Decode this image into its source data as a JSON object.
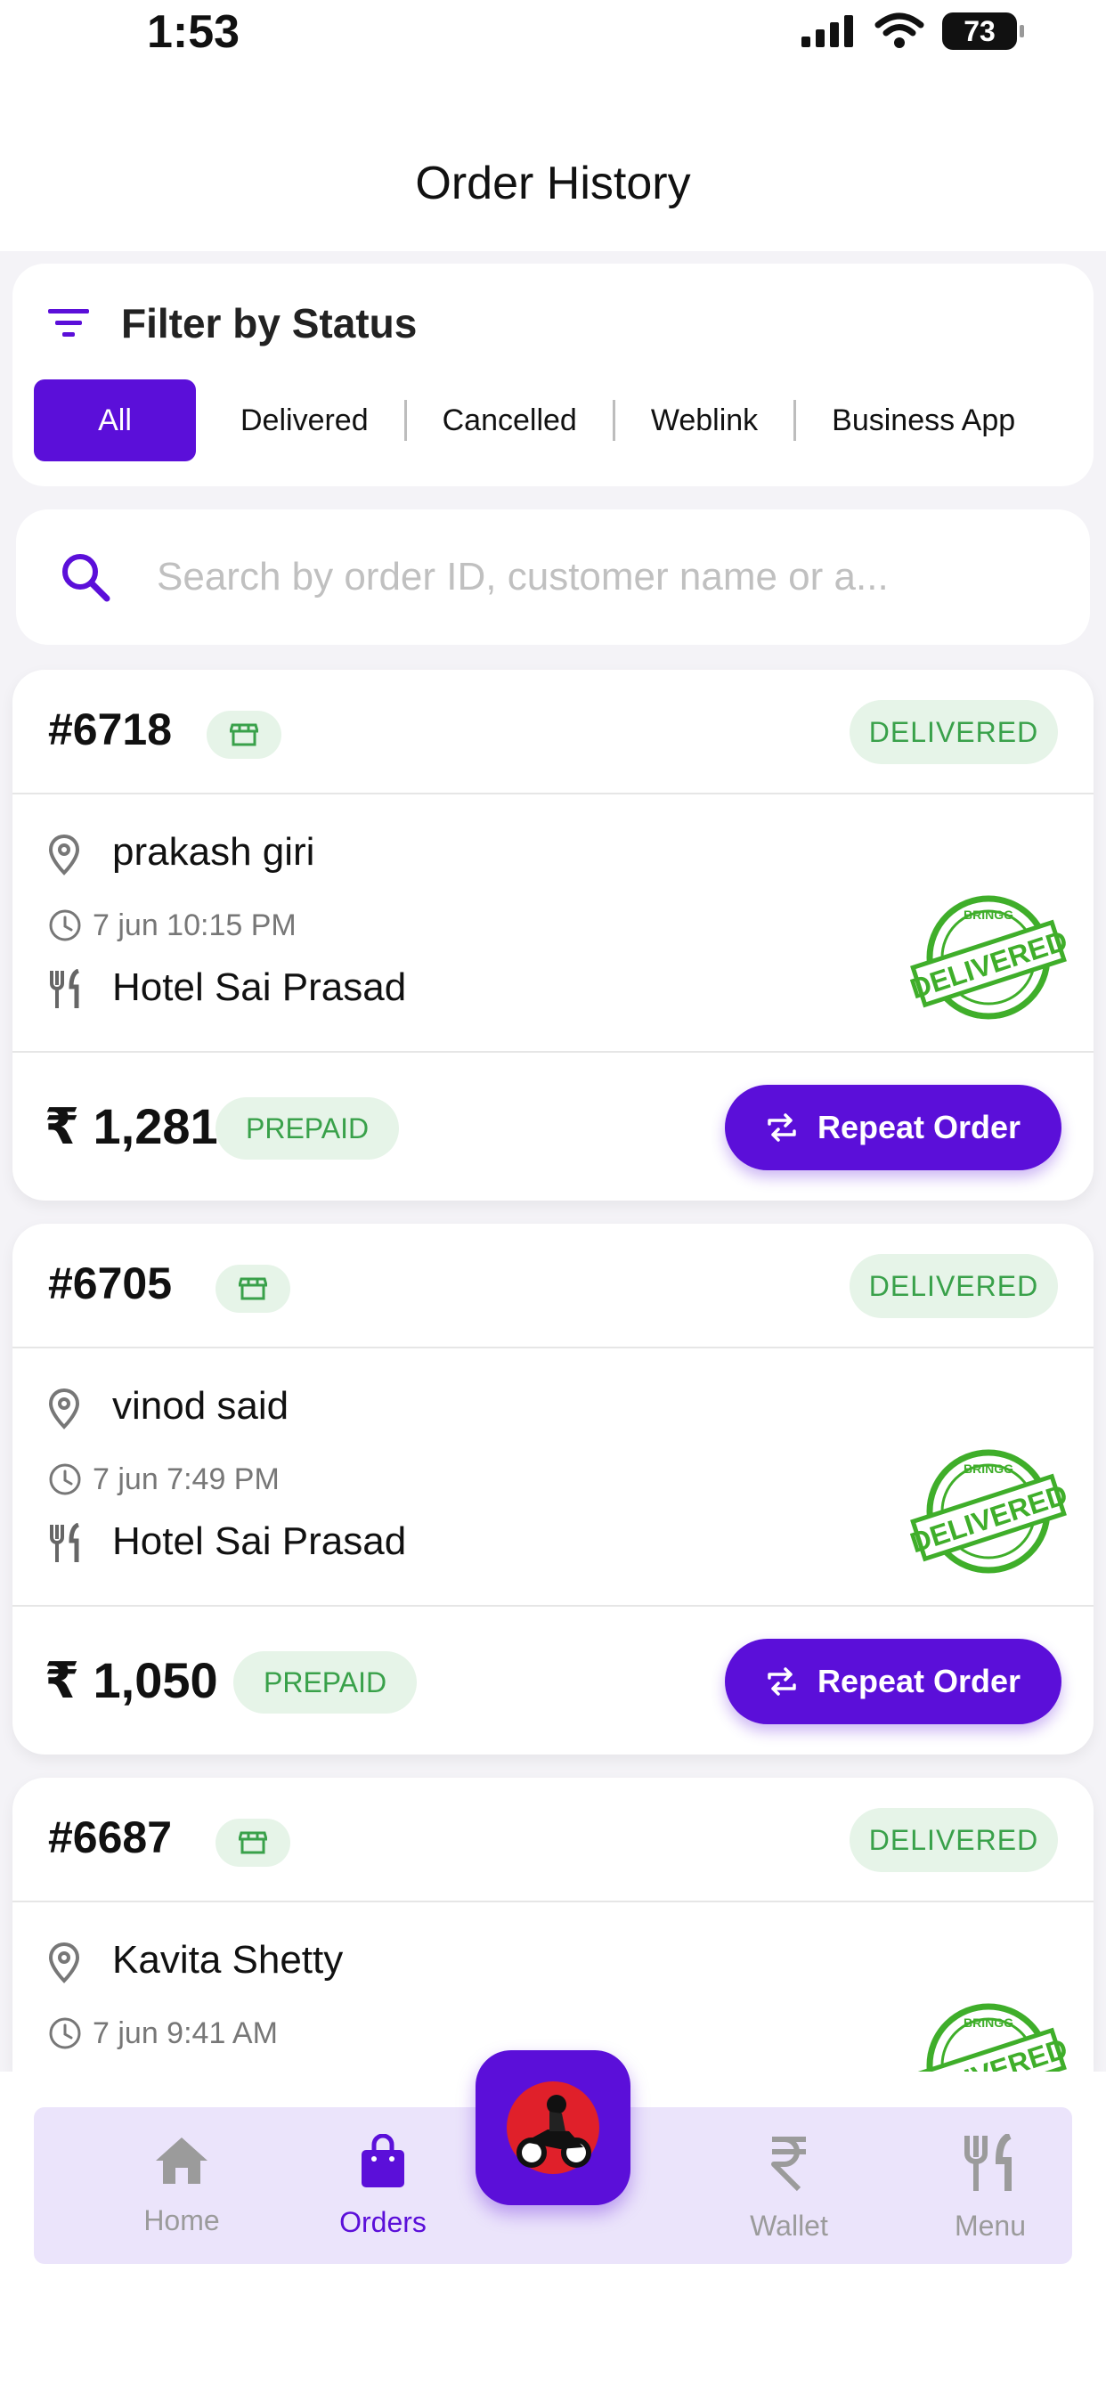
{
  "status_bar": {
    "time": "1:53",
    "battery": "73"
  },
  "header": {
    "title": "Order History"
  },
  "filter": {
    "title": "Filter by Status",
    "chips": [
      "All",
      "Delivered",
      "Cancelled",
      "Weblink",
      "Business App"
    ],
    "active": "All"
  },
  "search": {
    "placeholder": "Search by order ID, customer name or a..."
  },
  "orders": [
    {
      "id": "#6718",
      "status": "DELIVERED",
      "customer": "prakash giri",
      "time": "7 jun 10:15 PM",
      "restaurant": "Hotel Sai Prasad",
      "price": "₹ 1,281",
      "payment": "PREPAID",
      "action": "Repeat Order"
    },
    {
      "id": "#6705",
      "status": "DELIVERED",
      "customer": "vinod said",
      "time": "7 jun 7:49 PM",
      "restaurant": "Hotel Sai Prasad",
      "price": "₹ 1,050",
      "payment": "PREPAID",
      "action": "Repeat Order"
    },
    {
      "id": "#6687",
      "status": "DELIVERED",
      "customer": "Kavita Shetty",
      "time": "7 jun 9:41 AM"
    }
  ],
  "stamp": {
    "text": "DELIVERED",
    "top_text": "BRINGG"
  },
  "nav": [
    {
      "label": "Home",
      "icon": "home-icon"
    },
    {
      "label": "Orders",
      "icon": "shopping-bag-icon",
      "active": true
    },
    {
      "label": "Wallet",
      "icon": "rupee-icon"
    },
    {
      "label": "Menu",
      "icon": "fork-knife-icon"
    }
  ],
  "colors": {
    "accent": "#5b0fd9",
    "success": "#39a14a",
    "success_bg": "#e6f4e8"
  }
}
